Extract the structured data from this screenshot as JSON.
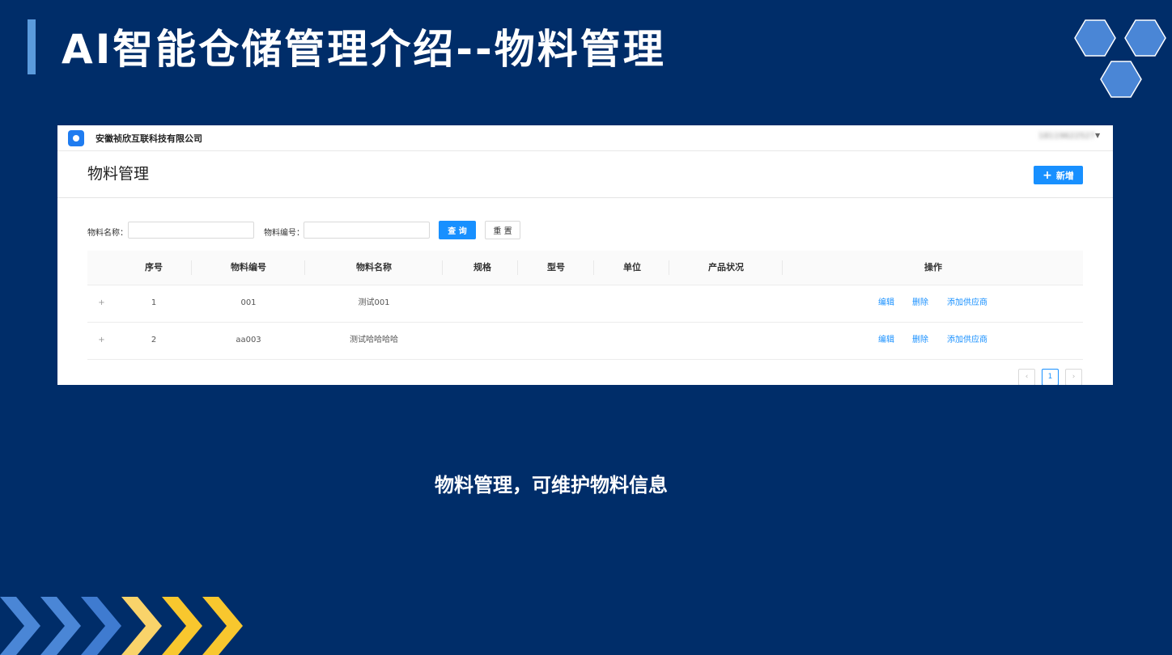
{
  "slide": {
    "title": "AI智能仓储管理介绍--物料管理",
    "caption": "物料管理，可维护物料信息",
    "colors": {
      "background": "#002d69",
      "accent_bar": "#5b9bdc",
      "hex": "#4a86d6",
      "chevron_blue": "#4a86d6",
      "chevron_yellow": "#f8c72e"
    }
  },
  "app": {
    "company": "安徽祯欣互联科技有限公司",
    "user": "18119622527",
    "page_title": "物料管理",
    "add_button": "新增",
    "filters": {
      "name_label": "物料名称：",
      "name_value": "",
      "code_label": "物料编号：",
      "code_value": "",
      "query_button": "查 询",
      "reset_button": "重 置"
    },
    "table": {
      "columns": [
        "序号",
        "物料编号",
        "物料名称",
        "规格",
        "型号",
        "单位",
        "产品状况",
        "操作"
      ],
      "rows": [
        {
          "expand": "+",
          "index": "1",
          "code": "001",
          "name": "测试001",
          "spec": "",
          "model": "",
          "unit": "",
          "status": "",
          "actions": [
            "编辑",
            "删除",
            "添加供应商"
          ]
        },
        {
          "expand": "+",
          "index": "2",
          "code": "aa003",
          "name": "测试哈哈哈哈",
          "spec": "",
          "model": "",
          "unit": "",
          "status": "",
          "actions": [
            "编辑",
            "删除",
            "添加供应商"
          ]
        }
      ]
    },
    "pagination": {
      "prev": "‹",
      "current": "1",
      "next": "›"
    }
  }
}
